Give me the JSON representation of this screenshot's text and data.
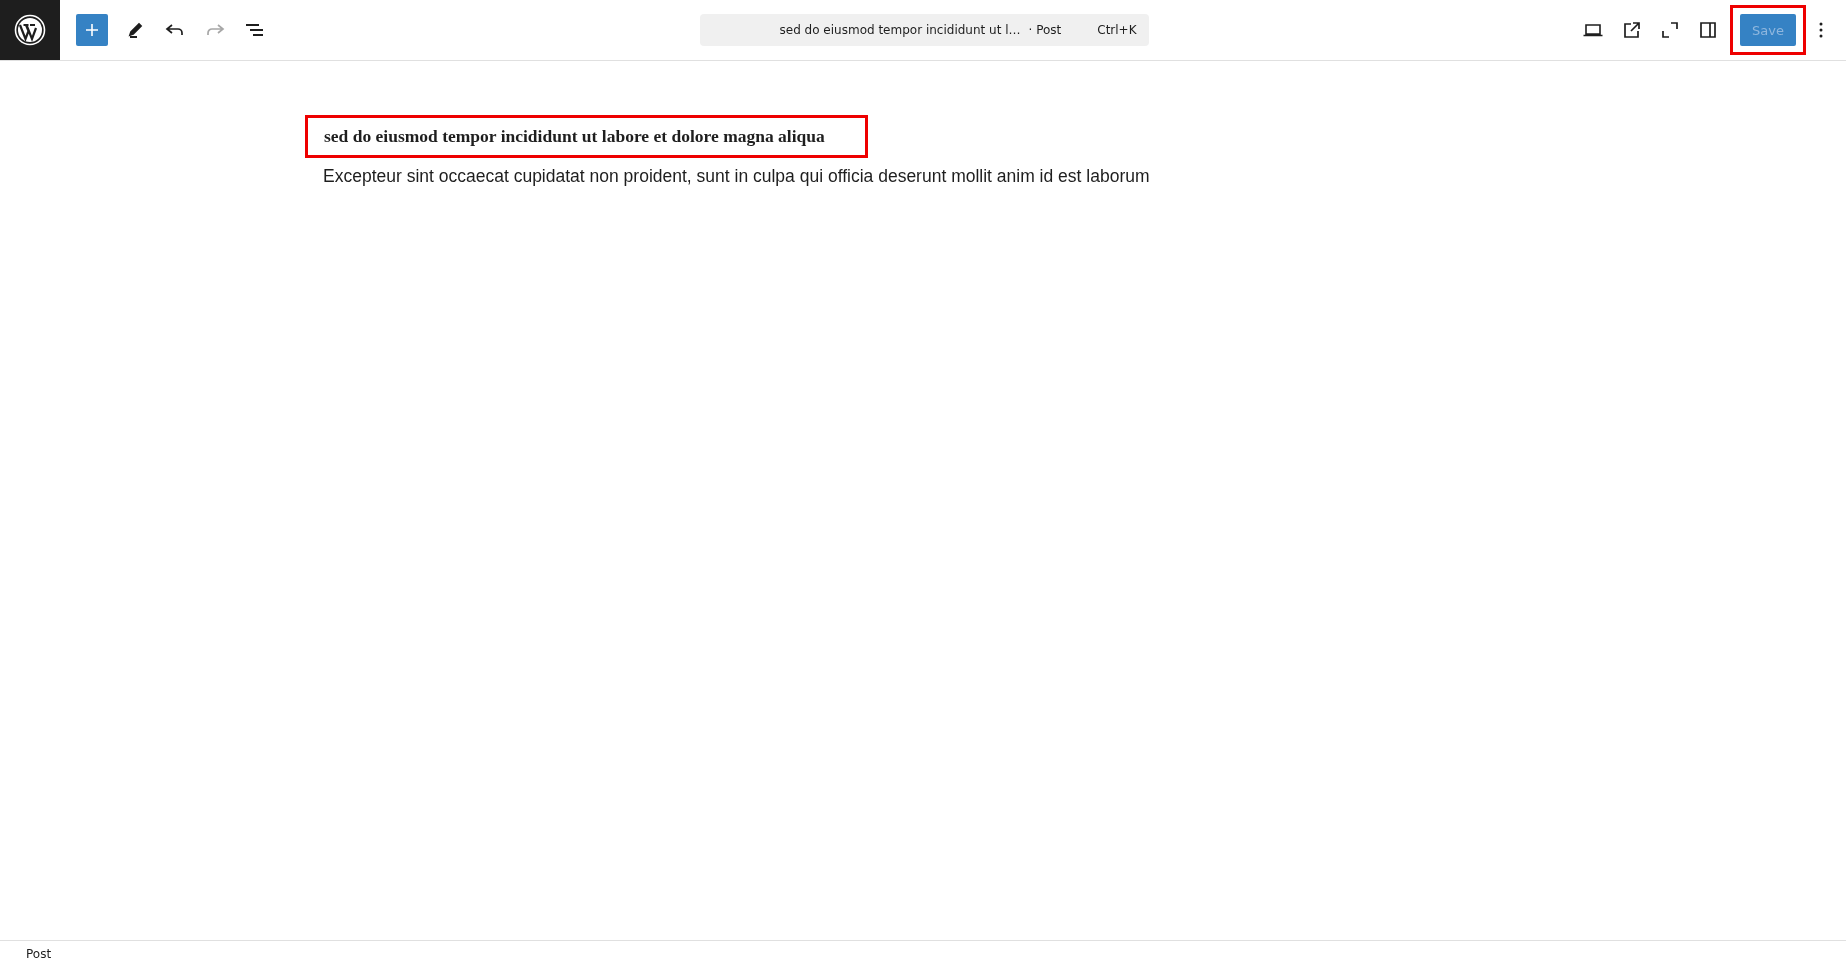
{
  "toolbar": {
    "redo_disabled": true
  },
  "command_bar": {
    "title": "sed do eiusmod tempor incididunt ut l…",
    "type": "· Post",
    "shortcut": "Ctrl+K"
  },
  "save_button": {
    "label": "Save",
    "highlighted": true,
    "disabled": true
  },
  "content": {
    "title": {
      "text": "sed do eiusmod tempor incididunt ut labore et dolore magna aliqua",
      "highlighted": true
    },
    "paragraph": "Excepteur sint occaecat cupidatat non proident, sunt in culpa qui officia deserunt mollit anim id est laborum"
  },
  "status_bar": {
    "breadcrumb": "Post"
  }
}
